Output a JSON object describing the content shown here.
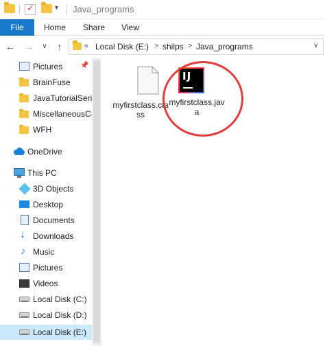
{
  "window": {
    "title": "Java_programs"
  },
  "ribbon": {
    "tabs": [
      "File",
      "Home",
      "Share",
      "View"
    ]
  },
  "address": {
    "overflow": "«",
    "crumbs": [
      "Local Disk (E:)",
      "shilps",
      "Java_programs"
    ],
    "separator": ">"
  },
  "nav_pane": {
    "items": [
      {
        "label": "Pictures",
        "icon": "pictures-icon",
        "pinned": true
      },
      {
        "label": "BrainFuse",
        "icon": "folder-icon"
      },
      {
        "label": "JavaTutorialSerie",
        "icon": "folder-icon"
      },
      {
        "label": "MiscellaneousC-",
        "icon": "folder-icon"
      },
      {
        "label": "WFH",
        "icon": "folder-icon"
      },
      {
        "label": "OneDrive",
        "icon": "onedrive-icon"
      },
      {
        "label": "This PC",
        "icon": "this-pc-icon"
      },
      {
        "label": "3D Objects",
        "icon": "3d-objects-icon"
      },
      {
        "label": "Desktop",
        "icon": "desktop-icon"
      },
      {
        "label": "Documents",
        "icon": "documents-icon"
      },
      {
        "label": "Downloads",
        "icon": "downloads-icon"
      },
      {
        "label": "Music",
        "icon": "music-icon"
      },
      {
        "label": "Pictures",
        "icon": "pictures-icon"
      },
      {
        "label": "Videos",
        "icon": "videos-icon"
      },
      {
        "label": "Local Disk (C:)",
        "icon": "drive-icon"
      },
      {
        "label": "Local Disk (D:)",
        "icon": "drive-icon"
      },
      {
        "label": "Local Disk (E:)",
        "icon": "drive-icon",
        "selected": true
      }
    ]
  },
  "files": [
    {
      "name": "myfirstclass.class",
      "icon": "class-file-icon"
    },
    {
      "name": "myfirstclass.java",
      "icon": "intellij-idea-icon"
    }
  ],
  "colors": {
    "file_tab": "#1979ca",
    "selection": "#cce8ff",
    "highlight_circle": "#e23c3c"
  }
}
